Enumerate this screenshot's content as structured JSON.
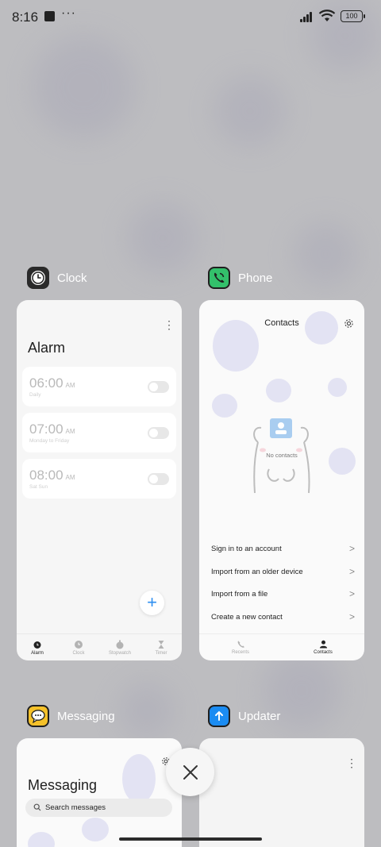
{
  "status_bar": {
    "time": "8:16",
    "dots": "···",
    "battery": "100"
  },
  "apps": {
    "clock": {
      "name": "Clock",
      "header": "Alarm",
      "alarms": [
        {
          "time": "06:00",
          "ampm": "AM",
          "repeat": "Daily"
        },
        {
          "time": "07:00",
          "ampm": "AM",
          "repeat": "Monday to Friday"
        },
        {
          "time": "08:00",
          "ampm": "AM",
          "repeat": "Sat Sun"
        }
      ],
      "fab": "+",
      "nav": [
        "Alarm",
        "Clock",
        "Stopwatch",
        "Timer"
      ]
    },
    "phone": {
      "name": "Phone",
      "title": "Contacts",
      "empty_text": "No contacts",
      "actions": [
        "Sign in to an account",
        "Import from an older device",
        "Import from a file",
        "Create a new contact"
      ],
      "chevron": ">",
      "nav": [
        "Recents",
        "Contacts"
      ]
    },
    "messaging": {
      "name": "Messaging",
      "title": "Messaging",
      "search_placeholder": "Search messages"
    },
    "updater": {
      "name": "Updater"
    }
  },
  "colors": {
    "background": "#bdbdc0",
    "card": "#f6f6f6",
    "accent_blue": "#2e8ff0",
    "phone_green": "#33c06b",
    "messaging_yellow": "#f5c12a",
    "updater_blue": "#1b8cf2"
  },
  "icons": [
    "clock-icon",
    "phone-icon",
    "messaging-icon",
    "updater-icon",
    "gear-icon",
    "close-icon",
    "search-icon"
  ]
}
